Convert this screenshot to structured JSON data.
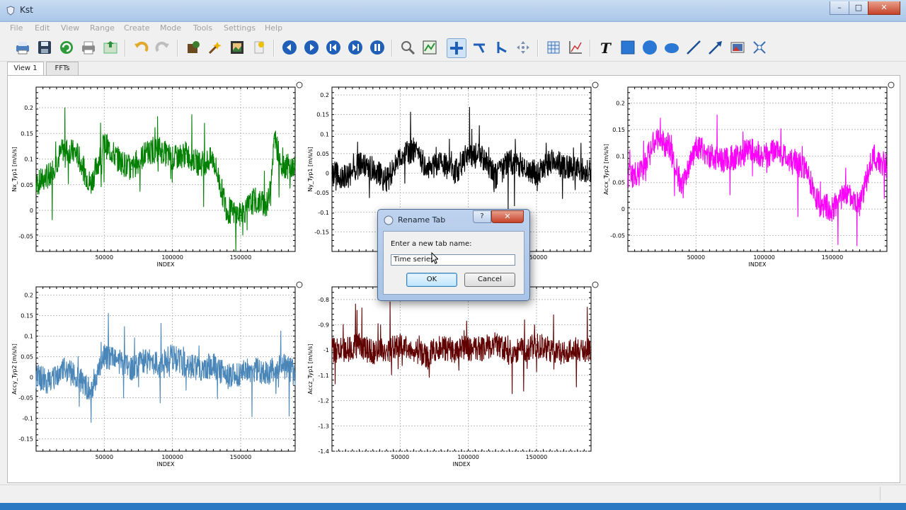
{
  "window": {
    "title": "Kst",
    "min": "–",
    "max": "□",
    "close": "✕"
  },
  "menu": [
    "File",
    "Edit",
    "View",
    "Range",
    "Create",
    "Mode",
    "Tools",
    "Settings",
    "Help"
  ],
  "toolbar": {
    "icons": [
      "print-icon",
      "save-icon",
      "reload-icon",
      "print-preview-icon",
      "export-icon",
      "undo-icon",
      "redo-icon",
      "data-manager-icon",
      "data-wizard-icon",
      "image-export-icon",
      "bookmark-icon",
      "back-icon",
      "forward-icon",
      "back-page-icon",
      "forward-page-icon",
      "pause-icon",
      "zoom-reset-icon",
      "zoom-fit-icon",
      "xy-zoom-icon",
      "x-zoom-icon",
      "y-zoom-icon",
      "layout-icon",
      "grid-icon",
      "plot-icon",
      "text-tool-icon",
      "box-tool-icon",
      "circle-tool-icon",
      "ellipse-tool-icon",
      "line-tool-icon",
      "arrow-tool-icon",
      "picture-tool-icon",
      "legend-tool-icon"
    ]
  },
  "tabs": [
    {
      "label": "View 1"
    },
    {
      "label": "FFTs"
    }
  ],
  "dialog": {
    "title": "Rename Tab",
    "help": "?",
    "close": "✕",
    "prompt": "Enter a new tab name:",
    "value": "Time series",
    "ok": "OK",
    "cancel": "Cancel"
  },
  "colors": {
    "green": "#008000",
    "black": "#000000",
    "magenta": "#ff00ff",
    "steelblue": "#4a86b8",
    "darkred": "#600000"
  },
  "chart_data": [
    {
      "type": "line",
      "ylabel": "Nx_Typ1 [m/s/s]",
      "xlabel": "INDEX",
      "color": "#008000",
      "xticks": [
        "50000",
        "100000",
        "150000"
      ],
      "yticks": [
        "0.2",
        "0.15",
        "0.1",
        "0.05",
        "0",
        "-0.05"
      ],
      "xlim": [
        0,
        190000
      ],
      "ylim": [
        -0.08,
        0.24
      ],
      "x": [
        0,
        10000,
        20000,
        30000,
        40000,
        50000,
        60000,
        70000,
        80000,
        90000,
        100000,
        110000,
        120000,
        130000,
        140000,
        150000,
        160000,
        170000,
        175000,
        180000,
        190000
      ],
      "y": [
        0.05,
        0.07,
        0.12,
        0.11,
        0.05,
        0.13,
        0.1,
        0.08,
        0.11,
        0.12,
        0.1,
        0.11,
        0.09,
        0.1,
        0.0,
        -0.01,
        0.02,
        0.01,
        0.14,
        0.09,
        0.08
      ]
    },
    {
      "type": "line",
      "ylabel": "Ny_Typ1 [m/s/s]",
      "xlabel": "INDEX",
      "color": "#000000",
      "xticks": [
        "50000",
        "100000",
        "150000"
      ],
      "yticks": [
        "0.2",
        "0.15",
        "0.1",
        "0.05",
        "0",
        "-0.05",
        "-0.1",
        "-0.15"
      ],
      "xlim": [
        0,
        190000
      ],
      "ylim": [
        -0.2,
        0.22
      ],
      "x": [
        0,
        10000,
        20000,
        30000,
        40000,
        50000,
        60000,
        70000,
        80000,
        90000,
        100000,
        110000,
        120000,
        130000,
        140000,
        150000,
        160000,
        170000,
        180000,
        190000
      ],
      "y": [
        0.0,
        -0.01,
        0.02,
        0.01,
        -0.02,
        0.04,
        0.06,
        0.01,
        0.03,
        0.0,
        0.05,
        0.04,
        -0.01,
        0.03,
        0.02,
        0.0,
        0.03,
        0.02,
        0.01,
        0.01
      ]
    },
    {
      "type": "line",
      "ylabel": "Accx_Typ2 [m/s/s]",
      "xlabel": "INDEX",
      "color": "#ff00ff",
      "xticks": [
        "50000",
        "100000",
        "150000"
      ],
      "yticks": [
        "0.2",
        "0.15",
        "0.1",
        "0.05",
        "0",
        "-0.05"
      ],
      "xlim": [
        0,
        190000
      ],
      "ylim": [
        -0.08,
        0.23
      ],
      "x": [
        0,
        10000,
        20000,
        30000,
        40000,
        50000,
        60000,
        70000,
        80000,
        90000,
        100000,
        110000,
        120000,
        130000,
        140000,
        150000,
        160000,
        170000,
        180000,
        190000
      ],
      "y": [
        0.06,
        0.07,
        0.13,
        0.12,
        0.04,
        0.12,
        0.1,
        0.09,
        0.1,
        0.11,
        0.1,
        0.11,
        0.09,
        0.08,
        0.01,
        0.0,
        0.03,
        0.01,
        0.1,
        0.08
      ]
    },
    {
      "type": "line",
      "ylabel": "Accy_Typ2 [m/s/s]",
      "xlabel": "INDEX",
      "color": "#4a86b8",
      "xticks": [
        "50000",
        "100000",
        "150000"
      ],
      "yticks": [
        "0.2",
        "0.15",
        "0.1",
        "0.05",
        "0",
        "-0.05",
        "-0.1",
        "-0.15"
      ],
      "xlim": [
        0,
        190000
      ],
      "ylim": [
        -0.18,
        0.22
      ],
      "x": [
        0,
        10000,
        20000,
        30000,
        40000,
        50000,
        60000,
        70000,
        80000,
        90000,
        100000,
        110000,
        120000,
        130000,
        140000,
        150000,
        160000,
        170000,
        180000,
        190000
      ],
      "y": [
        0.0,
        -0.01,
        0.02,
        0.0,
        -0.03,
        0.05,
        0.04,
        0.02,
        0.04,
        0.03,
        0.05,
        0.03,
        0.02,
        0.03,
        0.0,
        0.01,
        0.02,
        0.01,
        0.03,
        0.01
      ]
    },
    {
      "type": "line",
      "ylabel": "Accz_Typ1 [m/s/s]",
      "xlabel": "INDEX",
      "color": "#600000",
      "xticks": [
        "50000",
        "100000",
        "150000"
      ],
      "yticks": [
        "-0.8",
        "-0.9",
        "-1",
        "-1.1",
        "-1.2",
        "-1.3",
        "-1.4"
      ],
      "xlim": [
        0,
        190000
      ],
      "ylim": [
        -1.4,
        -0.75
      ],
      "x": [
        0,
        10000,
        20000,
        30000,
        40000,
        50000,
        60000,
        70000,
        80000,
        90000,
        100000,
        110000,
        120000,
        130000,
        140000,
        150000,
        160000,
        170000,
        180000,
        190000
      ],
      "y": [
        -1.0,
        -1.0,
        -0.98,
        -1.01,
        -1.0,
        -0.98,
        -1.0,
        -1.02,
        -0.99,
        -1.0,
        -0.99,
        -1.0,
        -0.97,
        -1.01,
        -1.0,
        -0.98,
        -1.0,
        -1.01,
        -1.0,
        -1.0
      ]
    }
  ]
}
